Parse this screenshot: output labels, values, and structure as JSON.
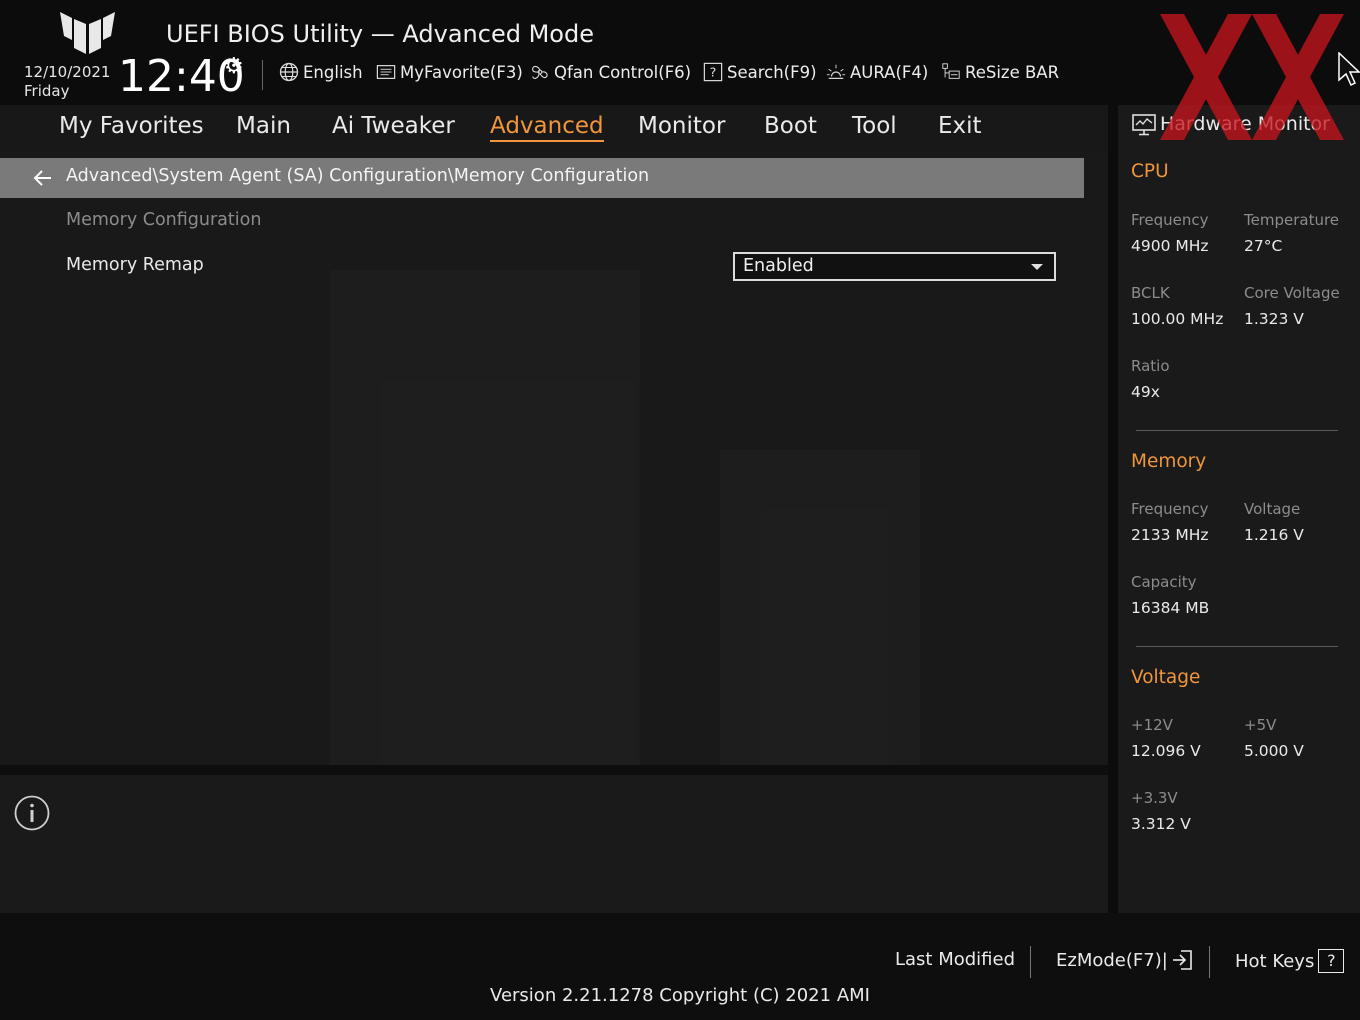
{
  "header": {
    "app_title": "UEFI BIOS Utility — Advanced Mode",
    "date": "12/10/2021",
    "day": "Friday",
    "time": "12:40",
    "toolbar": [
      {
        "label": "English",
        "icon": "globe-icon"
      },
      {
        "label": "MyFavorite(F3)",
        "icon": "favorite-list-icon"
      },
      {
        "label": "Qfan Control(F6)",
        "icon": "fan-icon"
      },
      {
        "label": "Search(F9)",
        "icon": "help-search-icon"
      },
      {
        "label": "AURA(F4)",
        "icon": "aura-light-icon"
      },
      {
        "label": "ReSize BAR",
        "icon": "resize-bar-icon"
      }
    ]
  },
  "nav": {
    "tabs": [
      "My Favorites",
      "Main",
      "Ai Tweaker",
      "Advanced",
      "Monitor",
      "Boot",
      "Tool",
      "Exit"
    ],
    "active": "Advanced"
  },
  "content": {
    "breadcrumb": "Advanced\\System Agent (SA) Configuration\\Memory Configuration",
    "section_title": "Memory Configuration",
    "settings": [
      {
        "label": "Memory Remap",
        "value": "Enabled"
      }
    ]
  },
  "hardware_monitor": {
    "title": "Hardware Monitor",
    "cpu": {
      "title": "CPU",
      "frequency_label": "Frequency",
      "frequency": "4900 MHz",
      "temperature_label": "Temperature",
      "temperature": "27°C",
      "bclk_label": "BCLK",
      "bclk": "100.00 MHz",
      "core_voltage_label": "Core Voltage",
      "core_voltage": "1.323 V",
      "ratio_label": "Ratio",
      "ratio": "49x"
    },
    "memory": {
      "title": "Memory",
      "frequency_label": "Frequency",
      "frequency": "2133 MHz",
      "voltage_label": "Voltage",
      "voltage": "1.216 V",
      "capacity_label": "Capacity",
      "capacity": "16384 MB"
    },
    "voltage": {
      "title": "Voltage",
      "v12_label": "+12V",
      "v12": "12.096 V",
      "v5_label": "+5V",
      "v5": "5.000 V",
      "v33_label": "+3.3V",
      "v33": "3.312 V"
    }
  },
  "footer": {
    "last_modified": "Last Modified",
    "ezmode": "EzMode(F7)|",
    "hotkeys": "Hot Keys",
    "hotkeys_icon": "?",
    "version": "Version 2.21.1278 Copyright (C) 2021 AMI"
  },
  "colors": {
    "accent": "#f0963c",
    "watermark": "#c8141e"
  }
}
